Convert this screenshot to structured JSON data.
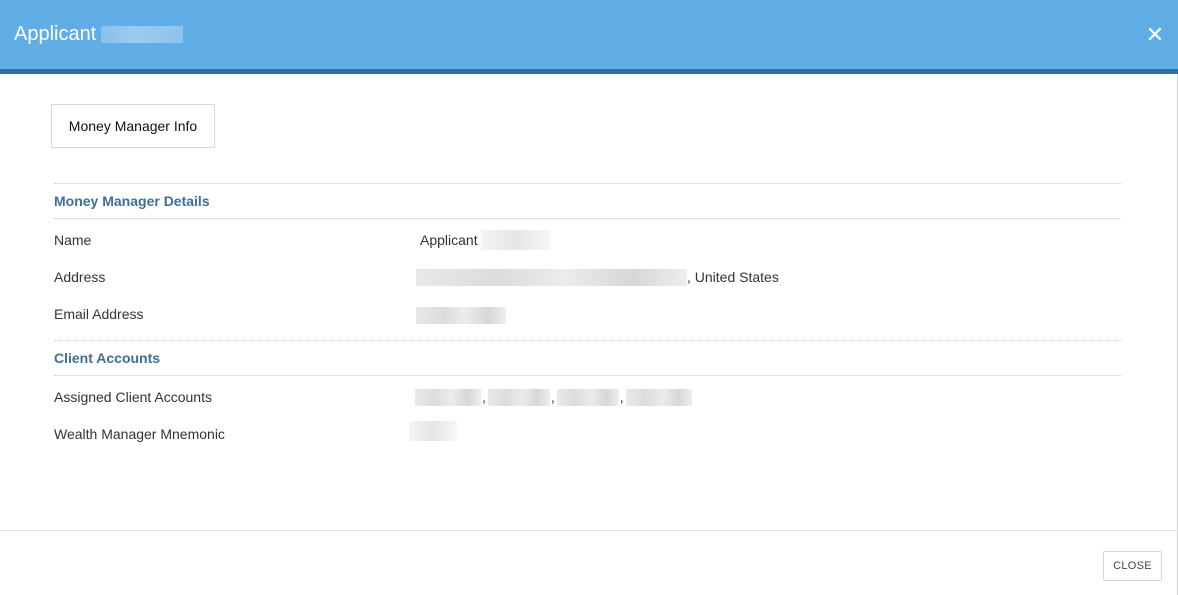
{
  "modal": {
    "title": "Applicant",
    "close_icon": "close-icon"
  },
  "tabs": [
    {
      "label": "Money Manager Info"
    }
  ],
  "sections": {
    "details": {
      "heading": "Money Manager Details",
      "name_label": "Name",
      "name_value": "Applicant",
      "address_label": "Address",
      "address_suffix": ", United States",
      "email_label": "Email Address"
    },
    "client_accounts": {
      "heading": "Client Accounts",
      "assigned_label": "Assigned Client Accounts",
      "mnemonic_label": "Wealth Manager Mnemonic"
    }
  },
  "footer": {
    "close_label": "CLOSE"
  },
  "colors": {
    "header_bg": "#61aee6",
    "header_border": "#2e72ad",
    "heading_text": "#3f6e99"
  }
}
